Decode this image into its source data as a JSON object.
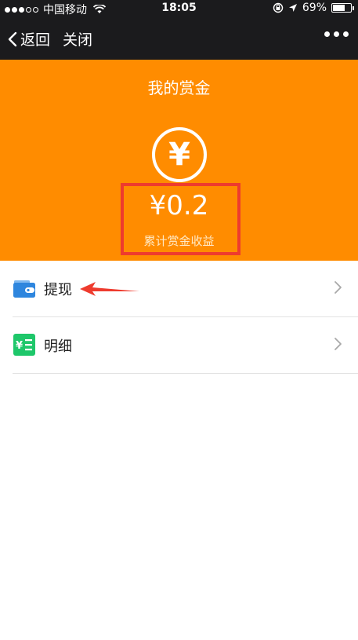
{
  "status_bar": {
    "carrier": "中国移动",
    "time": "18:05",
    "battery": "69%",
    "battery_level": 0.69
  },
  "nav": {
    "back_label": "返回",
    "close_label": "关闭"
  },
  "header": {
    "title": "我的赏金",
    "coin_symbol": "¥",
    "amount": "¥0.2",
    "amount_label": "累计赏金收益",
    "background_color": "#ff8c00",
    "highlight_color": "#ee3b2e"
  },
  "list": {
    "items": [
      {
        "label": "提现",
        "icon": "wallet-icon"
      },
      {
        "label": "明细",
        "icon": "ledger-icon"
      }
    ]
  }
}
